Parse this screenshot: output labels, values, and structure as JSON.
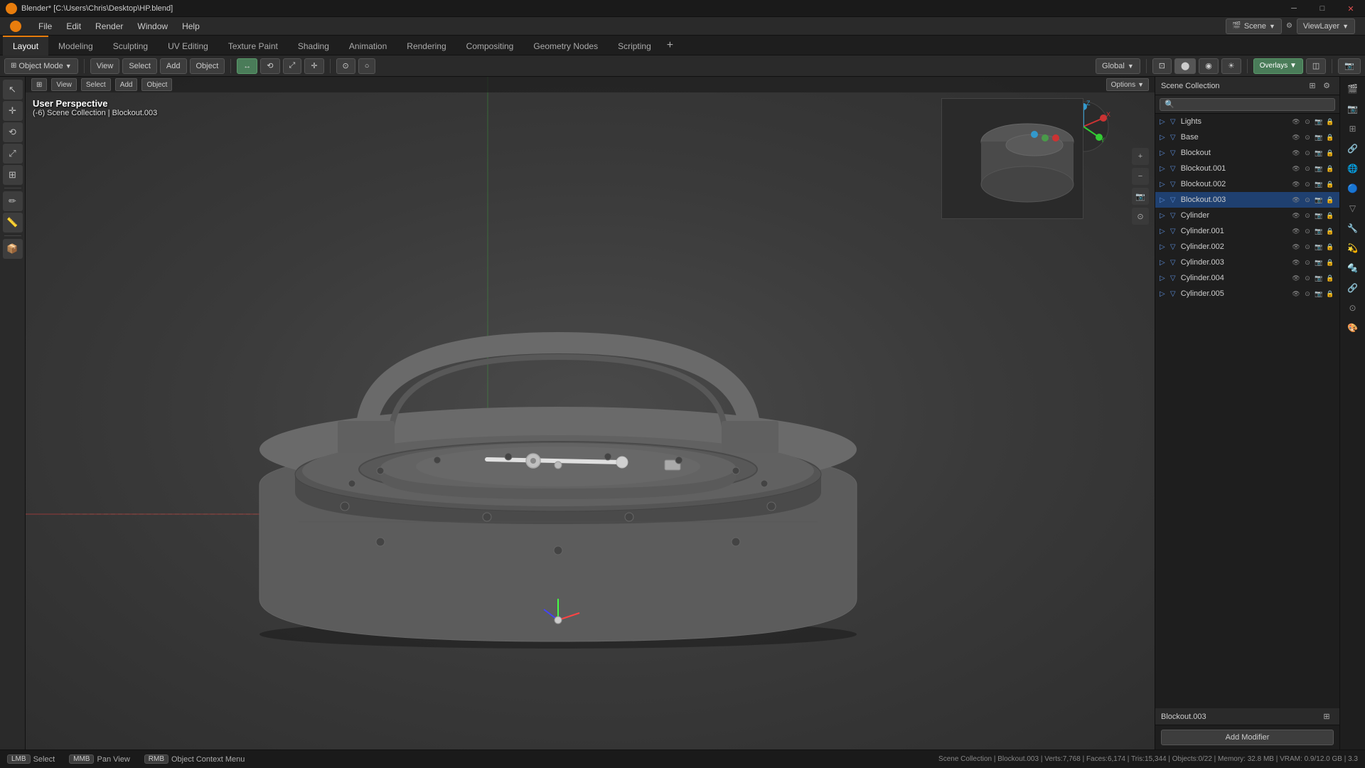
{
  "titleBar": {
    "icon": "blender-icon",
    "title": "Blender* [C:\\Users\\Chris\\Desktop\\HP.blend]",
    "minimize": "─",
    "maximize": "□",
    "close": "✕"
  },
  "menuBar": {
    "items": [
      "Blender",
      "File",
      "Edit",
      "Render",
      "Window",
      "Help"
    ]
  },
  "workspaceTabs": {
    "tabs": [
      "Layout",
      "Modeling",
      "Sculpting",
      "UV Editing",
      "Texture Paint",
      "Shading",
      "Animation",
      "Rendering",
      "Compositing",
      "Geometry Nodes",
      "Scripting"
    ],
    "active": "Layout",
    "addBtn": "+"
  },
  "toolbar": {
    "objectMode": "Object Mode",
    "view": "View",
    "select": "Select",
    "add": "Add",
    "object": "Object",
    "global": "Global",
    "snapping": "Snapping"
  },
  "viewport": {
    "viewName": "User Perspective",
    "collectionPath": "(-6) Scene Collection | Blockout.003",
    "scene": "Scene",
    "viewLayer": "ViewLayer",
    "options": "Options"
  },
  "outliner": {
    "title": "Scene Collection",
    "searchPlaceholder": "🔍",
    "items": [
      {
        "name": "Lights",
        "icon": "💡",
        "level": 1,
        "selected": false
      },
      {
        "name": "Base",
        "icon": "▽",
        "level": 1,
        "selected": false
      },
      {
        "name": "Blockout",
        "icon": "▽",
        "level": 1,
        "selected": false
      },
      {
        "name": "Blockout.001",
        "icon": "▽",
        "level": 1,
        "selected": false
      },
      {
        "name": "Blockout.002",
        "icon": "▽",
        "level": 1,
        "selected": false
      },
      {
        "name": "Blockout.003",
        "icon": "▽",
        "level": 1,
        "selected": true
      },
      {
        "name": "Cylinder",
        "icon": "▽",
        "level": 1,
        "selected": false
      },
      {
        "name": "Cylinder.001",
        "icon": "▽",
        "level": 1,
        "selected": false
      },
      {
        "name": "Cylinder.002",
        "icon": "▽",
        "level": 1,
        "selected": false
      },
      {
        "name": "Cylinder.003",
        "icon": "▽",
        "level": 1,
        "selected": false
      },
      {
        "name": "Cylinder.004",
        "icon": "▽",
        "level": 1,
        "selected": false
      },
      {
        "name": "Cylinder.005",
        "icon": "▽",
        "level": 1,
        "selected": false
      }
    ]
  },
  "properties": {
    "selectedObject": "Blockout.003",
    "addModifierLabel": "Add Modifier"
  },
  "statusBar": {
    "select": "Select",
    "panView": "Pan View",
    "objectContextMenu": "Object Context Menu",
    "stats": "Scene Collection | Blockout.003 | Verts:7,768 | Faces:6,174 | Tris:15,344 | Objects:0/22 | Memory: 32.8 MB | VRAM: 0.9/12.0 GB | 3.3"
  },
  "leftTools": {
    "tools": [
      "↖",
      "↔",
      "↕",
      "⟲",
      "⤢",
      "✏",
      "—",
      "🔧",
      "📐",
      "✂",
      "—",
      "💧",
      "📏",
      "—",
      "📦"
    ]
  },
  "propIcons": {
    "icons": [
      "🔧",
      "📷",
      "🔗",
      "🌐",
      "👁",
      "⚙",
      "🎭",
      "🎨",
      "🔩",
      "📊",
      "💫",
      "🔲"
    ]
  }
}
